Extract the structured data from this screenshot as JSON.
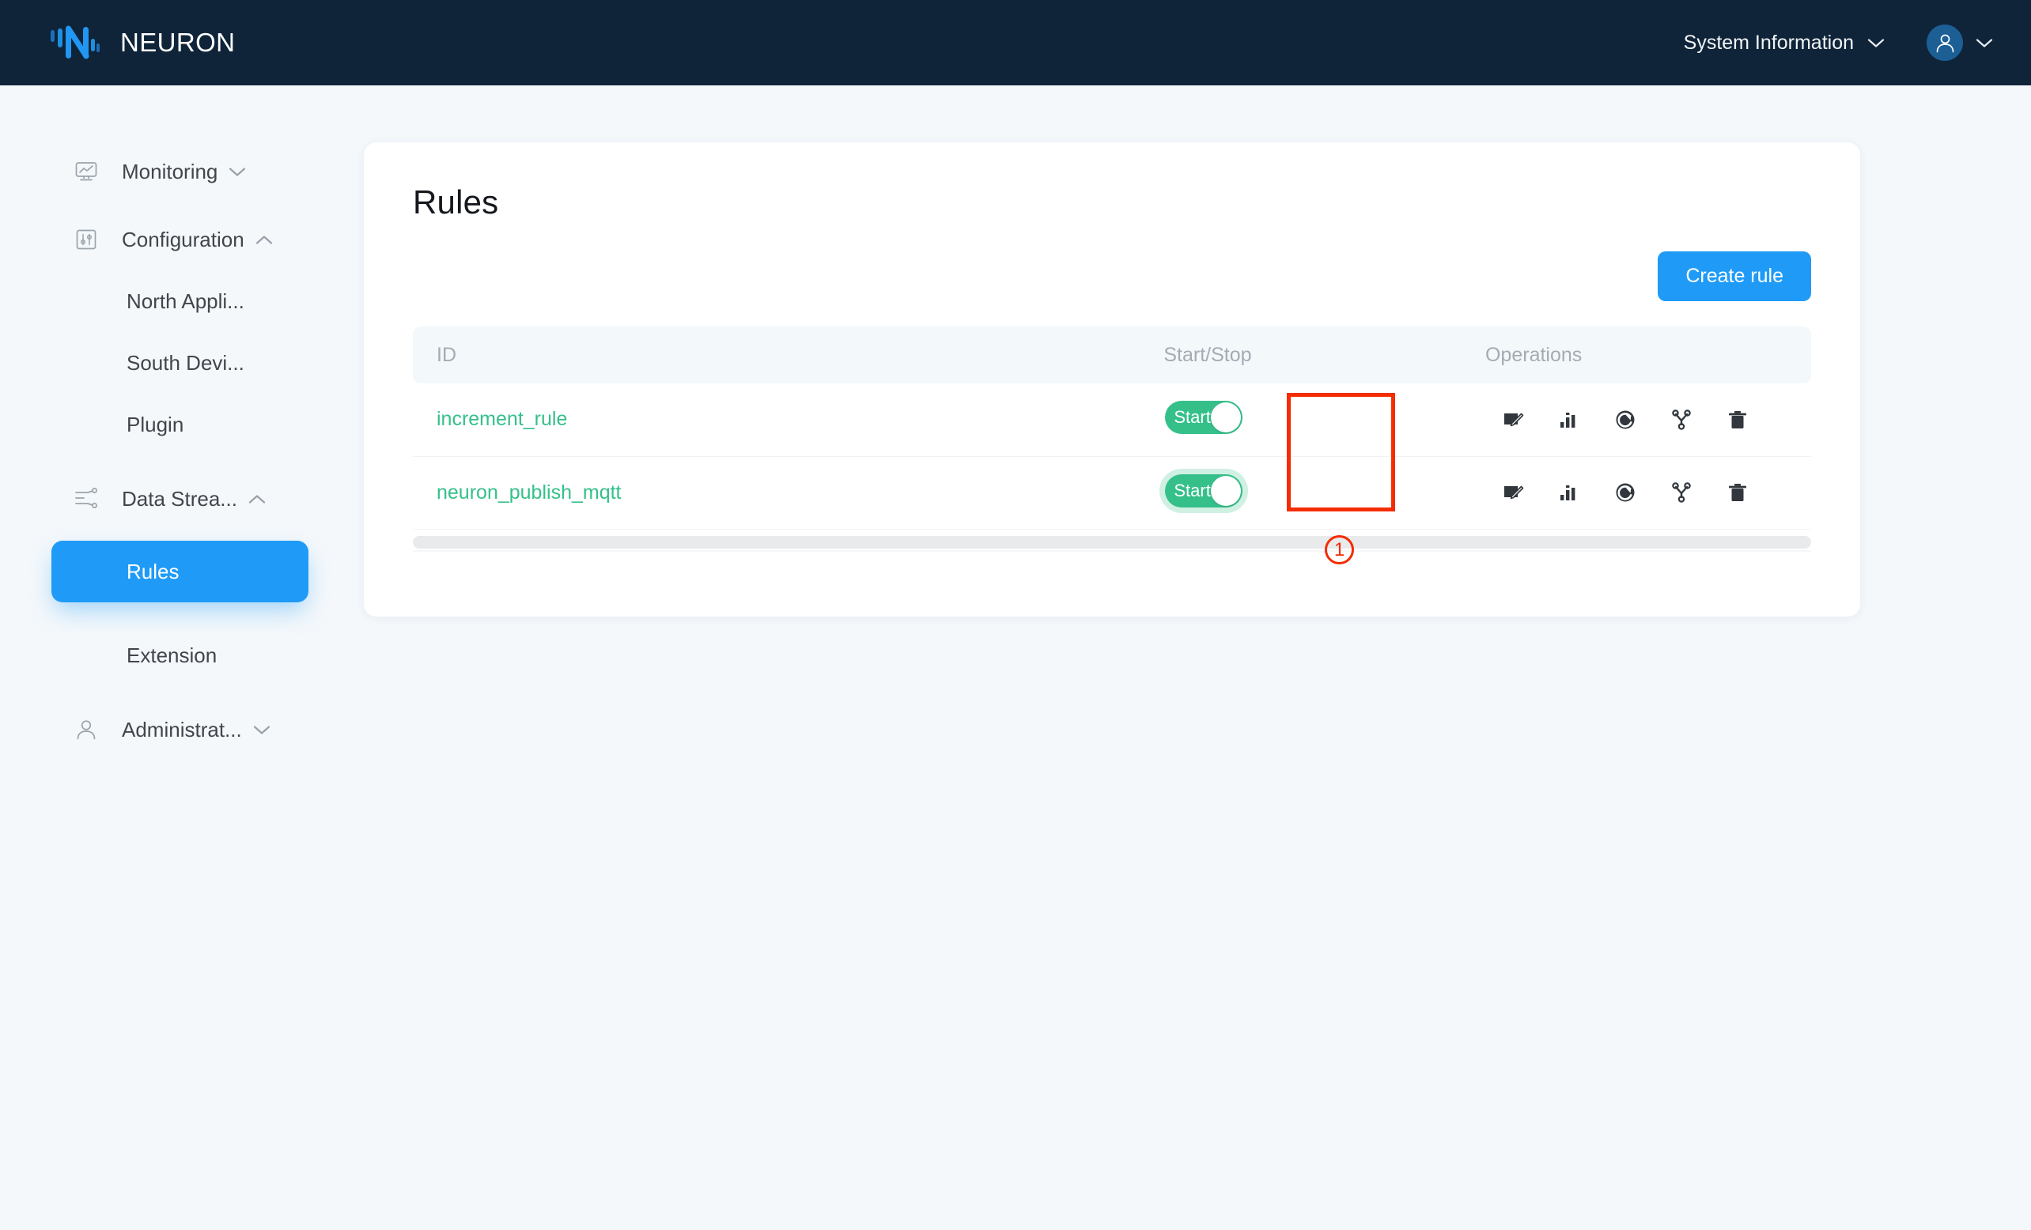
{
  "header": {
    "brand": "NEURON",
    "logo_icon": "neuron-bars-logo",
    "system_information_label": "System Information",
    "system_information_chevron": "chevron-down-icon",
    "avatar_icon": "user-icon",
    "avatar_chevron": "chevron-down-icon",
    "bar_color": "#0f2438",
    "logo_color": "#1f9bf7"
  },
  "sidebar": {
    "groups": [
      {
        "label": "Monitoring",
        "icon": "monitor-chart-icon",
        "chevron": "chevron-down-icon",
        "expanded": false,
        "children": []
      },
      {
        "label": "Configuration",
        "icon": "sliders-icon",
        "chevron": "chevron-up-icon",
        "expanded": true,
        "children": [
          {
            "label": "North Appli...",
            "active": false
          },
          {
            "label": "South Devi...",
            "active": false
          },
          {
            "label": "Plugin",
            "active": false
          }
        ]
      },
      {
        "label": "Data Strea...",
        "icon": "data-flow-icon",
        "chevron": "chevron-up-icon",
        "expanded": true,
        "children": [
          {
            "label": "Rules",
            "active": true
          },
          {
            "label": "Extension",
            "active": false
          }
        ]
      },
      {
        "label": "Administrat...",
        "icon": "person-icon",
        "chevron": "chevron-down-icon",
        "expanded": false,
        "children": []
      }
    ],
    "active_item": "Rules",
    "active_color": "#1f9bf7"
  },
  "main": {
    "page_title": "Rules",
    "create_button_label": "Create rule",
    "table": {
      "columns": [
        "ID",
        "Start/Stop",
        "Operations"
      ],
      "rows": [
        {
          "id": "increment_rule",
          "toggle": {
            "label": "Start",
            "on": true,
            "focused": false
          },
          "operations": [
            "edit-icon",
            "status-chart-icon",
            "restart-icon",
            "topology-icon",
            "delete-icon"
          ]
        },
        {
          "id": "neuron_publish_mqtt",
          "toggle": {
            "label": "Start",
            "on": true,
            "focused": true
          },
          "operations": [
            "edit-icon",
            "status-chart-icon",
            "restart-icon",
            "topology-icon",
            "delete-icon"
          ]
        }
      ],
      "id_link_color": "#35c08a",
      "toggle_on_color": "#35c08a",
      "header_bg": "#f3f8fb"
    },
    "horizontal_scrollbar": true
  },
  "annotations": {
    "highlight_box": {
      "target": "start-stop-toggles",
      "color": "#f42c00"
    },
    "step_badge": {
      "number": "1",
      "color": "#f42c00"
    }
  }
}
